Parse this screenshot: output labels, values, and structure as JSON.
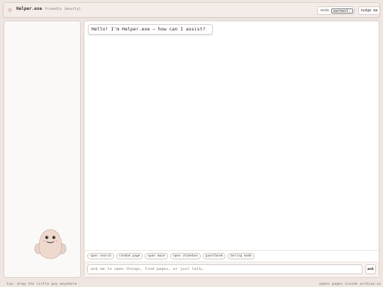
{
  "header": {
    "title": "Helper.exe",
    "subtitle": "— friendly (mostly)",
    "mode_label": "mode",
    "mode_value": "earnest",
    "nudge_label": "nudge me"
  },
  "chat": {
    "greeting": "Hello! I'm Helper.exe — how can I assist?",
    "quick_actions": [
      {
        "label": "open search"
      },
      {
        "label": "random page"
      },
      {
        "label": "open maze"
      },
      {
        "label": "open chimebox"
      },
      {
        "label": "guestbook"
      },
      {
        "label": "boring mode"
      }
    ],
    "input_placeholder": "ask me to open things, find pages, or just talk…",
    "ask_label": "ask"
  },
  "footer": {
    "tip": "tip: drag the little guy anywhere",
    "note": "opens pages inside archive.os"
  },
  "colors": {
    "background": "#efe6e1",
    "panel": "#ffffff",
    "accent": "#e7c9c2",
    "creature_body": "#efd9cf"
  }
}
